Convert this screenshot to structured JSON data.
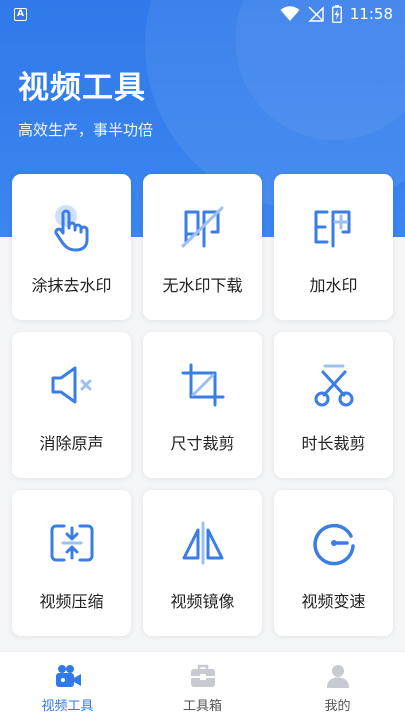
{
  "status_bar": {
    "time": "11:58"
  },
  "header": {
    "title": "视频工具",
    "subtitle": "高效生产，事半功倍"
  },
  "tools": [
    {
      "label": "涂抹去水印",
      "icon": "tap-hand-icon"
    },
    {
      "label": "无水印下载",
      "icon": "watermark-off-icon"
    },
    {
      "label": "加水印",
      "icon": "watermark-add-icon"
    },
    {
      "label": "消除原声",
      "icon": "mute-speaker-icon"
    },
    {
      "label": "尺寸裁剪",
      "icon": "crop-icon"
    },
    {
      "label": "时长裁剪",
      "icon": "scissors-icon"
    },
    {
      "label": "视频压缩",
      "icon": "compress-icon"
    },
    {
      "label": "视频镜像",
      "icon": "mirror-icon"
    },
    {
      "label": "视频变速",
      "icon": "speed-gauge-icon"
    }
  ],
  "tab_bar": {
    "items": [
      {
        "label": "视频工具",
        "icon": "video-camera-icon",
        "active": true
      },
      {
        "label": "工具箱",
        "icon": "toolbox-icon",
        "active": false
      },
      {
        "label": "我的",
        "icon": "user-icon",
        "active": false
      }
    ]
  },
  "colors": {
    "accent": "#2f79ea",
    "icon_blue": "#3a7de4",
    "icon_light": "#9dc0f3"
  }
}
